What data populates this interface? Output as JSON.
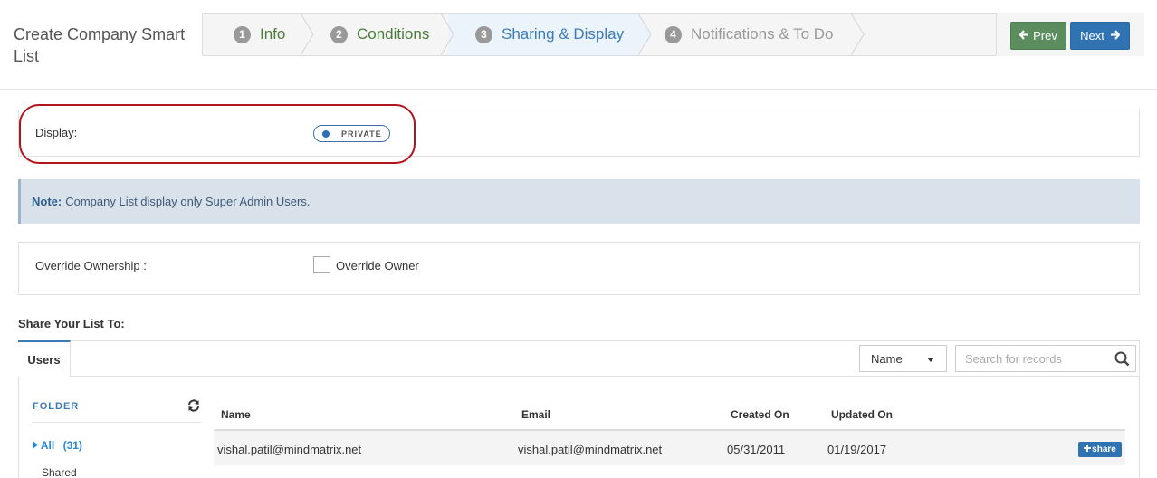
{
  "page": {
    "title": "Create Company Smart List"
  },
  "wizard": {
    "steps": [
      {
        "num": "1",
        "label": "Info"
      },
      {
        "num": "2",
        "label": "Conditions"
      },
      {
        "num": "3",
        "label": "Sharing & Display"
      },
      {
        "num": "4",
        "label": "Notifications & To Do"
      }
    ],
    "prev_label": "Prev",
    "next_label": "Next"
  },
  "display": {
    "label": "Display:",
    "toggle_text": "PRIVATE"
  },
  "note": {
    "prefix": "Note:",
    "text": "Company List display only Super Admin Users."
  },
  "override": {
    "label": "Override Ownership :",
    "checkbox_label": "Override Owner",
    "checked": false
  },
  "share": {
    "title": "Share Your List To:",
    "tab": "Users",
    "sort_select": "Name",
    "search_placeholder": "Search for records",
    "folder": {
      "header": "FOLDER",
      "all_label": "All",
      "all_count": "(31)",
      "shared_label": "Shared"
    },
    "table": {
      "headers": {
        "name": "Name",
        "email": "Email",
        "created": "Created On",
        "updated": "Updated On"
      },
      "rows": [
        {
          "name": "vishal.patil@mindmatrix.net",
          "email": "vishal.patil@mindmatrix.net",
          "created": "05/31/2011",
          "updated": "01/19/2017",
          "action": "share"
        }
      ]
    }
  },
  "colors": {
    "accent": "#3a7bb8",
    "prev_button": "#5c8d5e",
    "next_button": "#2f73b3",
    "highlight_ring": "#b0141c",
    "note_bg": "#d9e1ea"
  }
}
